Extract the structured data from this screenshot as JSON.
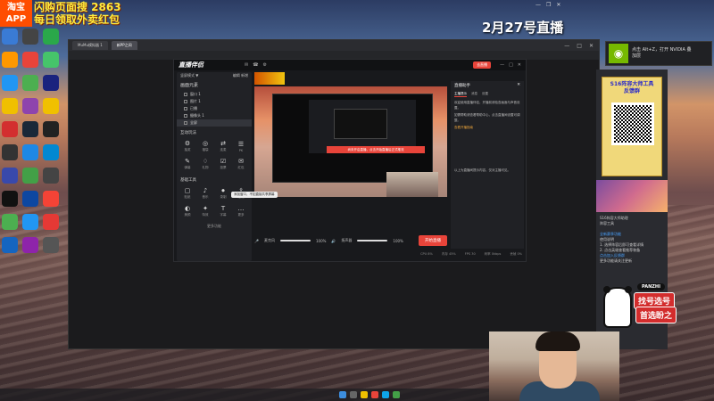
{
  "promo": {
    "app_label_1": "淘宝",
    "app_label_2": "APP",
    "line1": "闪购页面搜 2863",
    "line2": "每日领取外卖红包"
  },
  "overlay": {
    "stream_date": "2月27号直播"
  },
  "desktop_icons": [
    {
      "label": "",
      "color": "#3a7bd5"
    },
    {
      "label": "",
      "color": "#444"
    },
    {
      "label": "",
      "color": "#2aa84a"
    },
    {
      "label": "",
      "color": "#ff9800"
    },
    {
      "label": "",
      "color": "#e8443a"
    },
    {
      "label": "",
      "color": "#46c46a"
    },
    {
      "label": "",
      "color": "#2196f3"
    },
    {
      "label": "",
      "color": "#4caf50"
    },
    {
      "label": "",
      "color": "#1a237e"
    },
    {
      "label": "",
      "color": "#f0c000"
    },
    {
      "label": "",
      "color": "#8e44ad"
    },
    {
      "label": "",
      "color": "#f0c000"
    },
    {
      "label": "",
      "color": "#d32f2f"
    },
    {
      "label": "",
      "color": "#1b2838"
    },
    {
      "label": "",
      "color": "#222"
    },
    {
      "label": "",
      "color": "#333"
    },
    {
      "label": "",
      "color": "#1e88e5"
    },
    {
      "label": "",
      "color": "#0288d1"
    },
    {
      "label": "",
      "color": "#3949ab"
    },
    {
      "label": "",
      "color": "#43a047"
    },
    {
      "label": "",
      "color": "#444"
    },
    {
      "label": "",
      "color": "#111"
    },
    {
      "label": "",
      "color": "#0d47a1"
    },
    {
      "label": "",
      "color": "#f44336"
    },
    {
      "label": "",
      "color": "#4caf50"
    },
    {
      "label": "",
      "color": "#2196f3"
    },
    {
      "label": "",
      "color": "#e53935"
    },
    {
      "label": "",
      "color": "#1565c0"
    },
    {
      "label": "",
      "color": "#8e24aa"
    },
    {
      "label": "",
      "color": "#555"
    }
  ],
  "window": {
    "tab1": "MuMu模拟器 1",
    "tab2": "新PP之间",
    "controls": [
      "—",
      "□",
      "✕"
    ]
  },
  "live_app": {
    "logo": "直播伴侣",
    "start_small": "去直播",
    "header_icons": [
      "✉",
      "☎",
      "⚙",
      "—",
      "□",
      "✕"
    ],
    "left_mode": "竖屏模式 ▼",
    "left_mode_right": "编辑  新增",
    "scene_title": "画面元素",
    "scenes": [
      "窗口 1",
      "图片 1",
      "已播",
      "摄像头 1",
      "全屏"
    ],
    "section_interact": "互动玩法",
    "interact_tools": [
      "抽奖",
      "福袋",
      "连麦",
      "PK",
      "弹幕",
      "礼物",
      "投票",
      "红包"
    ],
    "section_basic": "基础工具",
    "basic_tools": [
      "贴纸",
      "音乐",
      "录制",
      "推流",
      "美颜",
      "特效",
      "字幕",
      "更多"
    ],
    "more": "更多功能",
    "tooltip": "添加窗口，不如直接共享屏幕",
    "overlay_msg": "尚未开启直播，点击开始直播后正式推流",
    "audio_label1": "麦克风",
    "audio_value1": "100%",
    "audio_label2": "扬声器",
    "audio_value2": "100%",
    "start_live": "开始直播",
    "status": [
      "CPU 8%",
      "内存 45%",
      "FPS 30",
      "码率 0kbps",
      "丢帧 0%"
    ],
    "right_title": "直播助手",
    "right_tabs": [
      "主播提示",
      "消息",
      "设置"
    ],
    "right_text1": "欢迎使用直播伴侣，开播前请检查画面与声音设置。",
    "right_text2": "如需帮助请查看帮助中心，点击直播间设置可调整。",
    "right_link": "查看开播指南",
    "right_text3": "以上为直播间提示内容，仅对主播可见。"
  },
  "nvidia": {
    "line1": "点击 Alt+Z，打开 NVIDIA 叠",
    "line2": "加层"
  },
  "side_panel": {
    "card_title": "S16阵容大师工具",
    "card_title2": "反馈群",
    "line1": "S16阵容大师助理",
    "line2": "阵容工具",
    "section": "全新赛季功能",
    "line3": "使用说明",
    "line4": "1. 选择阵容后即可查看详情",
    "line5": "2. 点击英雄查看推荐装备",
    "link": "点击加入反馈群",
    "line6": "更多功能请关注更新",
    "line7": "随时调整"
  },
  "panzhi": {
    "tag": "PANZHI",
    "line1": "找号选号",
    "line2": "首选盼之"
  }
}
